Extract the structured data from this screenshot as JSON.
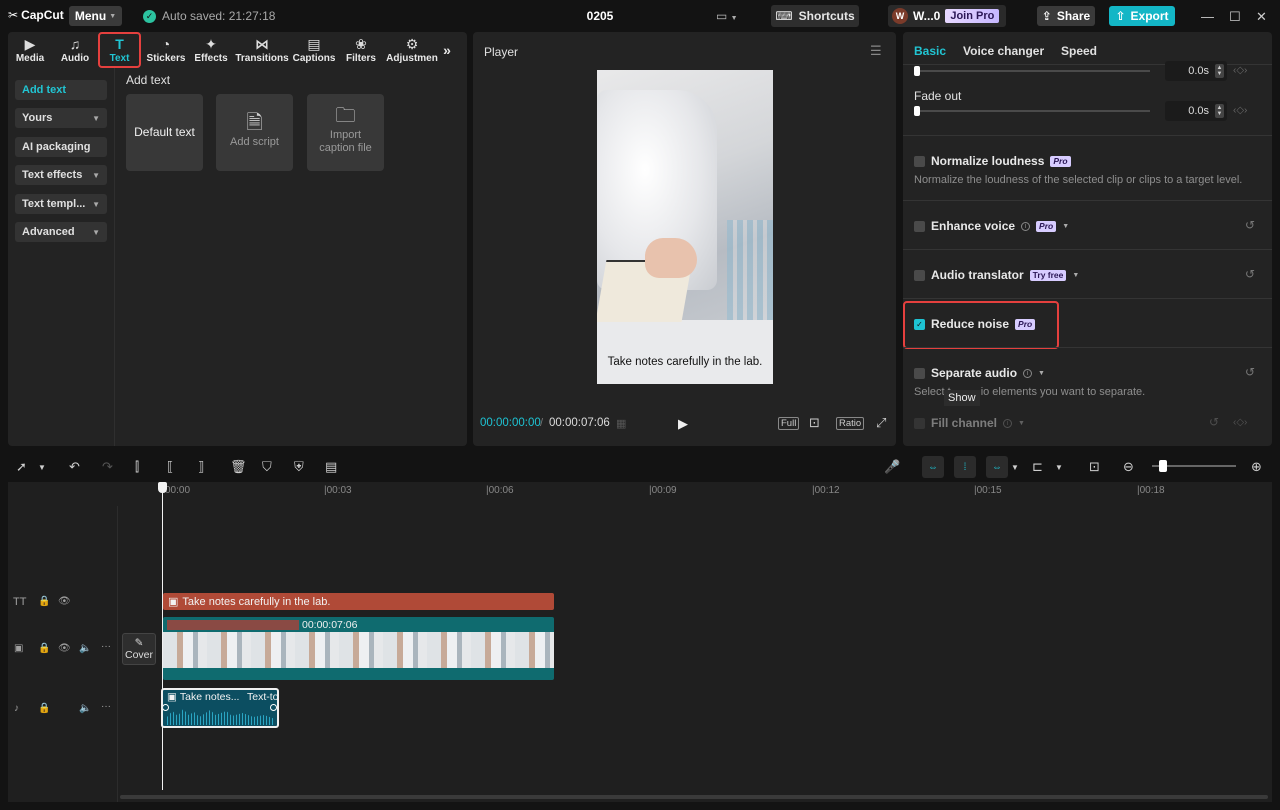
{
  "titlebar": {
    "app_name": "CapCut",
    "menu_label": "Menu",
    "autosave_text": "Auto saved: 21:27:18",
    "project_title": "0205",
    "shortcuts_label": "Shortcuts",
    "user_name": "W...0",
    "join_pro_label": "Join Pro",
    "share_label": "Share",
    "export_label": "Export"
  },
  "media_tabs": [
    {
      "label": "Media",
      "icon": "media-icon"
    },
    {
      "label": "Audio",
      "icon": "audio-icon"
    },
    {
      "label": "Text",
      "icon": "text-icon",
      "active": true
    },
    {
      "label": "Stickers",
      "icon": "stickers-icon"
    },
    {
      "label": "Effects",
      "icon": "effects-icon"
    },
    {
      "label": "Transitions",
      "icon": "transitions-icon"
    },
    {
      "label": "Captions",
      "icon": "captions-icon"
    },
    {
      "label": "Filters",
      "icon": "filters-icon"
    },
    {
      "label": "Adjustmen",
      "icon": "adjustment-icon"
    }
  ],
  "text_nav": [
    {
      "label": "Add text",
      "active": true
    },
    {
      "label": "Yours",
      "dropdown": true
    },
    {
      "label": "AI packaging"
    },
    {
      "label": "Text effects",
      "dropdown": true
    },
    {
      "label": "Text templ...",
      "dropdown": true
    },
    {
      "label": "Advanced",
      "dropdown": true
    }
  ],
  "add_text": {
    "title": "Add text",
    "cards": [
      {
        "label": "Default text"
      },
      {
        "label": "Add script",
        "icon": "script-icon"
      },
      {
        "label": "Import caption file",
        "icon": "folder-icon"
      }
    ]
  },
  "player": {
    "title": "Player",
    "caption": "Take notes carefully in the lab.",
    "current_time": "00:00:00:00",
    "total_time": "00:00:07:06",
    "full_label": "Full",
    "ratio_label": "Ratio"
  },
  "right_panel": {
    "tabs": [
      {
        "label": "Basic",
        "active": true
      },
      {
        "label": "Voice changer"
      },
      {
        "label": "Speed"
      }
    ],
    "fade_in_value": "0.0s",
    "fade_out_label": "Fade out",
    "fade_out_value": "0.0s",
    "options": {
      "normalize": {
        "label": "Normalize loudness",
        "badge": "Pro",
        "desc": "Normalize the loudness of the selected clip or clips to a target level.",
        "checked": false
      },
      "enhance": {
        "label": "Enhance voice",
        "badge": "Pro",
        "checked": false
      },
      "translator": {
        "label": "Audio translator",
        "badge": "Try free",
        "checked": false
      },
      "reduce_noise": {
        "label": "Reduce noise",
        "badge": "Pro",
        "checked": true
      },
      "separate": {
        "label": "Separate audio",
        "desc_a": "Select t",
        "desc_b": "io elements you want to separate.",
        "checked": false
      },
      "fill_channel": {
        "label": "Fill channel",
        "checked": false
      }
    },
    "tooltip": "Show"
  },
  "timeline": {
    "ruler": [
      "00:00",
      "|00:03",
      "|00:06",
      "|00:09",
      "|00:12",
      "|00:15",
      "|00:18"
    ],
    "text_clip_label": "Take notes carefully in the lab.",
    "video_clip_duration": "00:00:07:06",
    "cover_label": "Cover",
    "audio_clip_label": "Take notes...",
    "audio_clip_label2": "Text-to"
  },
  "colors": {
    "accent": "#21c5d3",
    "highlight": "#e5403e",
    "text_clip": "#b04a37",
    "video_clip": "#0f6b6f",
    "audio_clip": "#0c4e61"
  }
}
